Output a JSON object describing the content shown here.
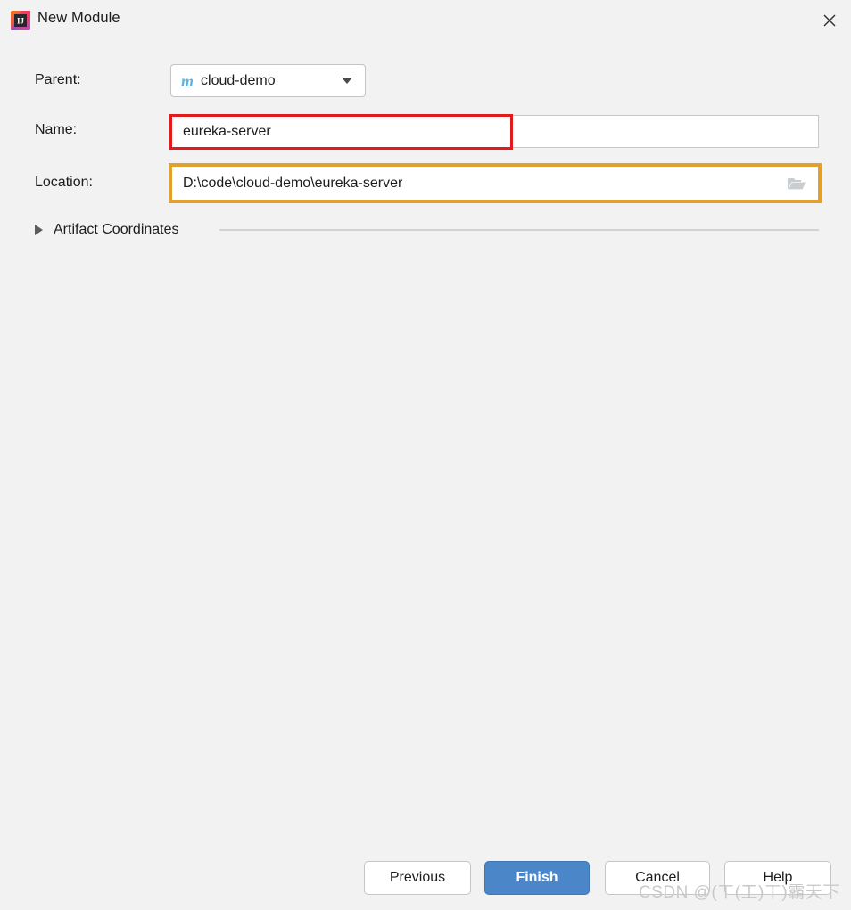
{
  "window": {
    "title": "New Module",
    "app_icon": "intellij-idea-icon",
    "close_icon": "close-icon",
    "background_color": "#f2f2f2"
  },
  "form": {
    "parent": {
      "label": "Parent:",
      "value": "cloud-demo",
      "icon": "maven-module-icon",
      "icon_letter": "m",
      "icon_color": "#5bb5e0",
      "dropdown_icon": "chevron-down-icon"
    },
    "name": {
      "label": "Name:",
      "value": "eureka-server",
      "placeholder": "",
      "highlight_color": "#e01b1b"
    },
    "location": {
      "label": "Location:",
      "value": "D:\\code\\cloud-demo\\eureka-server",
      "placeholder": "",
      "browse_icon": "folder-open-icon",
      "highlight_color": "#e3a12c"
    },
    "artifact_coordinates": {
      "label": "Artifact Coordinates",
      "expanded": false,
      "toggle_icon": "triangle-right-icon"
    }
  },
  "footer": {
    "previous_label": "Previous",
    "finish_label": "Finish",
    "cancel_label": "Cancel",
    "help_label": "Help",
    "finish_color": "#4a86c8"
  },
  "watermark": {
    "text": "CSDN @(ㄒ(工)ㄒ)霸天下"
  }
}
